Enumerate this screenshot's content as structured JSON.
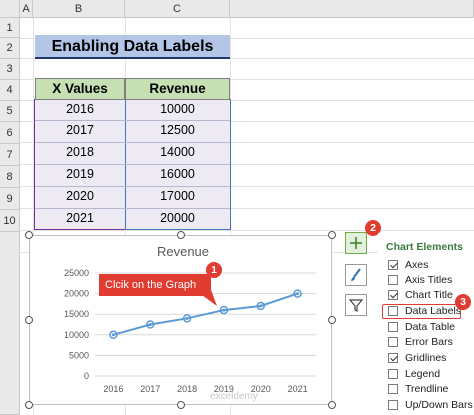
{
  "sheet": {
    "columns": [
      "A",
      "B",
      "C"
    ],
    "rows": [
      "1",
      "2",
      "3",
      "4",
      "5",
      "6",
      "7",
      "8",
      "9",
      "10"
    ]
  },
  "title": "Enabling Data Labels",
  "table": {
    "headers": [
      "X Values",
      "Revenue"
    ],
    "rows": [
      [
        "2016",
        "10000"
      ],
      [
        "2017",
        "12500"
      ],
      [
        "2018",
        "14000"
      ],
      [
        "2019",
        "16000"
      ],
      [
        "2020",
        "17000"
      ],
      [
        "2021",
        "20000"
      ]
    ]
  },
  "chart_data": {
    "type": "line",
    "title": "Revenue",
    "categories": [
      "2016",
      "2017",
      "2018",
      "2019",
      "2020",
      "2021"
    ],
    "series": [
      {
        "values": [
          10000,
          12500,
          14000,
          16000,
          17000,
          20000
        ]
      }
    ],
    "ylim": [
      0,
      25000
    ],
    "yticks": [
      "0",
      "5000",
      "10000",
      "15000",
      "20000",
      "25000"
    ],
    "grid": true,
    "line_color": "#5b9bd5"
  },
  "watermark": "exceldemy",
  "callouts": {
    "graph": "Clcik on the Graph",
    "step1": "1",
    "step2": "2",
    "step3": "3"
  },
  "side_buttons": [
    "plus-icon",
    "brush-icon",
    "filter-icon"
  ],
  "chart_elements": {
    "title": "Chart Elements",
    "items": [
      {
        "label": "Axes",
        "checked": true
      },
      {
        "label": "Axis Titles",
        "checked": false
      },
      {
        "label": "Chart Title",
        "checked": true
      },
      {
        "label": "Data Labels",
        "checked": false
      },
      {
        "label": "Data Table",
        "checked": false
      },
      {
        "label": "Error Bars",
        "checked": false
      },
      {
        "label": "Gridlines",
        "checked": true
      },
      {
        "label": "Legend",
        "checked": false
      },
      {
        "label": "Trendline",
        "checked": false
      },
      {
        "label": "Up/Down Bars",
        "checked": false
      }
    ]
  },
  "colors": {
    "accent_red": "#e03c31",
    "header_green": "#c6e0b4",
    "title_blue": "#b4c6e7",
    "panel_title": "#3b7a3b"
  }
}
